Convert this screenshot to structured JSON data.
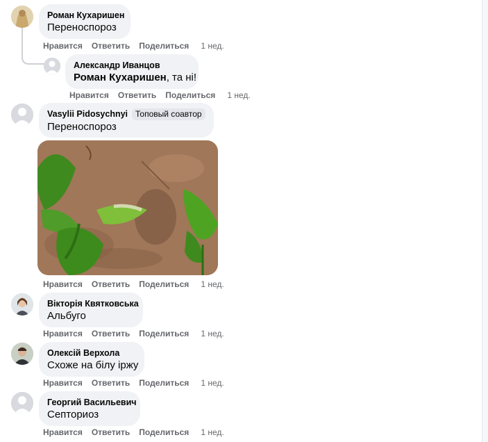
{
  "comments": [
    {
      "author": "Роман Кухаришен",
      "text": "Переноспороз",
      "actions": {
        "like": "Нравится",
        "reply": "Ответить",
        "share": "Поделиться",
        "time": "1 нед."
      },
      "reply": {
        "author": "Александр Иванцов",
        "mention": "Роман Кухаришен",
        "text": ", та ні!",
        "actions": {
          "like": "Нравится",
          "reply": "Ответить",
          "share": "Поделиться",
          "time": "1 нед."
        }
      }
    },
    {
      "author": "Vasylii Pidosychnyi",
      "badge": "Топовый соавтор",
      "text": "Переноспороз",
      "photo_alt": "pepper seedling with diseased leaf on soil",
      "actions": {
        "like": "Нравится",
        "reply": "Ответить",
        "share": "Поделиться",
        "time": "1 нед."
      }
    },
    {
      "author": "Вікторія Квятковська",
      "text": "Альбуго",
      "actions": {
        "like": "Нравится",
        "reply": "Ответить",
        "share": "Поделиться",
        "time": "1 нед."
      }
    },
    {
      "author": "Олексій Верхола",
      "text": "Схоже на білу іржу",
      "actions": {
        "like": "Нравится",
        "reply": "Ответить",
        "share": "Поделиться",
        "time": "1 нед."
      }
    },
    {
      "author": "Георгий Васильевич",
      "text": "Септориоз",
      "actions": {
        "like": "Нравится",
        "reply": "Ответить",
        "share": "Поделиться",
        "time": "1 нед."
      }
    }
  ],
  "colors": {
    "bubble": "#f0f2f5",
    "meta": "#65676b",
    "text": "#050505"
  }
}
